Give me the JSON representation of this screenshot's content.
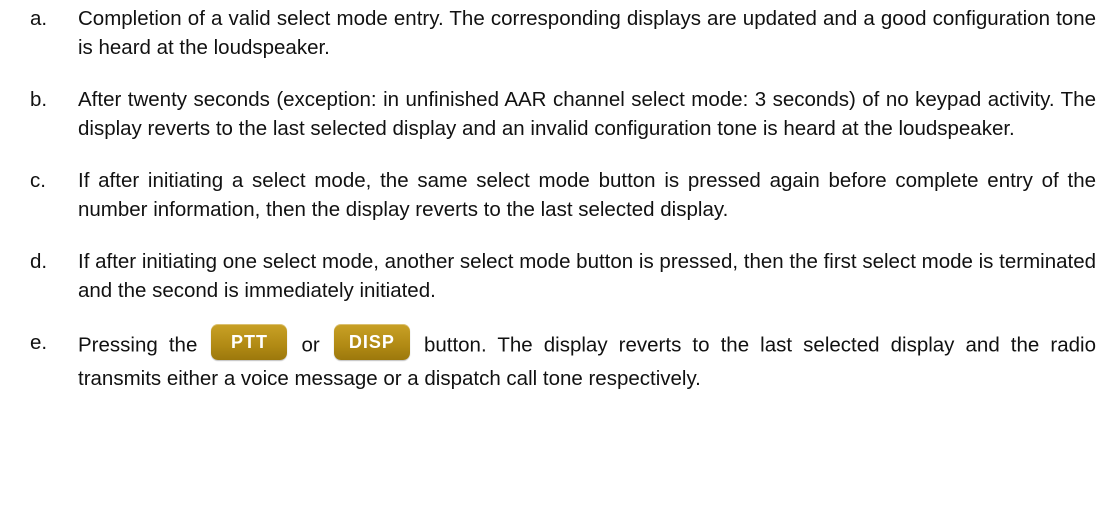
{
  "items": [
    {
      "marker": "a.",
      "text": "Completion of a valid select mode entry. The corresponding displays are updated and a good configuration tone is heard at the loudspeaker."
    },
    {
      "marker": "b.",
      "text": "After twenty seconds (exception: in unfinished AAR channel select mode: 3 seconds) of no keypad activity. The display reverts to the last selected display and an invalid configu­ration tone is heard at the loudspeaker."
    },
    {
      "marker": "c.",
      "text": "If after initiating a select mode, the same select mode button is pressed again before complete entry of the number information, then the display reverts to the last selected display."
    },
    {
      "marker": "d.",
      "text": "If after initiating one select mode, another select mode button is pressed, then the first select mode is terminated and the second is immediately initiated."
    },
    {
      "marker": "e.",
      "text_before": "Pressing the",
      "button1": "PTT",
      "connector": "or",
      "button2": "DISP",
      "text_after": "button. The display reverts to the last selected display and the radio transmits either a voice message or a dispatch call tone respectively."
    }
  ],
  "colors": {
    "button_fill": "#b18a14",
    "button_text": "#ffffff",
    "body_text": "#111111"
  }
}
